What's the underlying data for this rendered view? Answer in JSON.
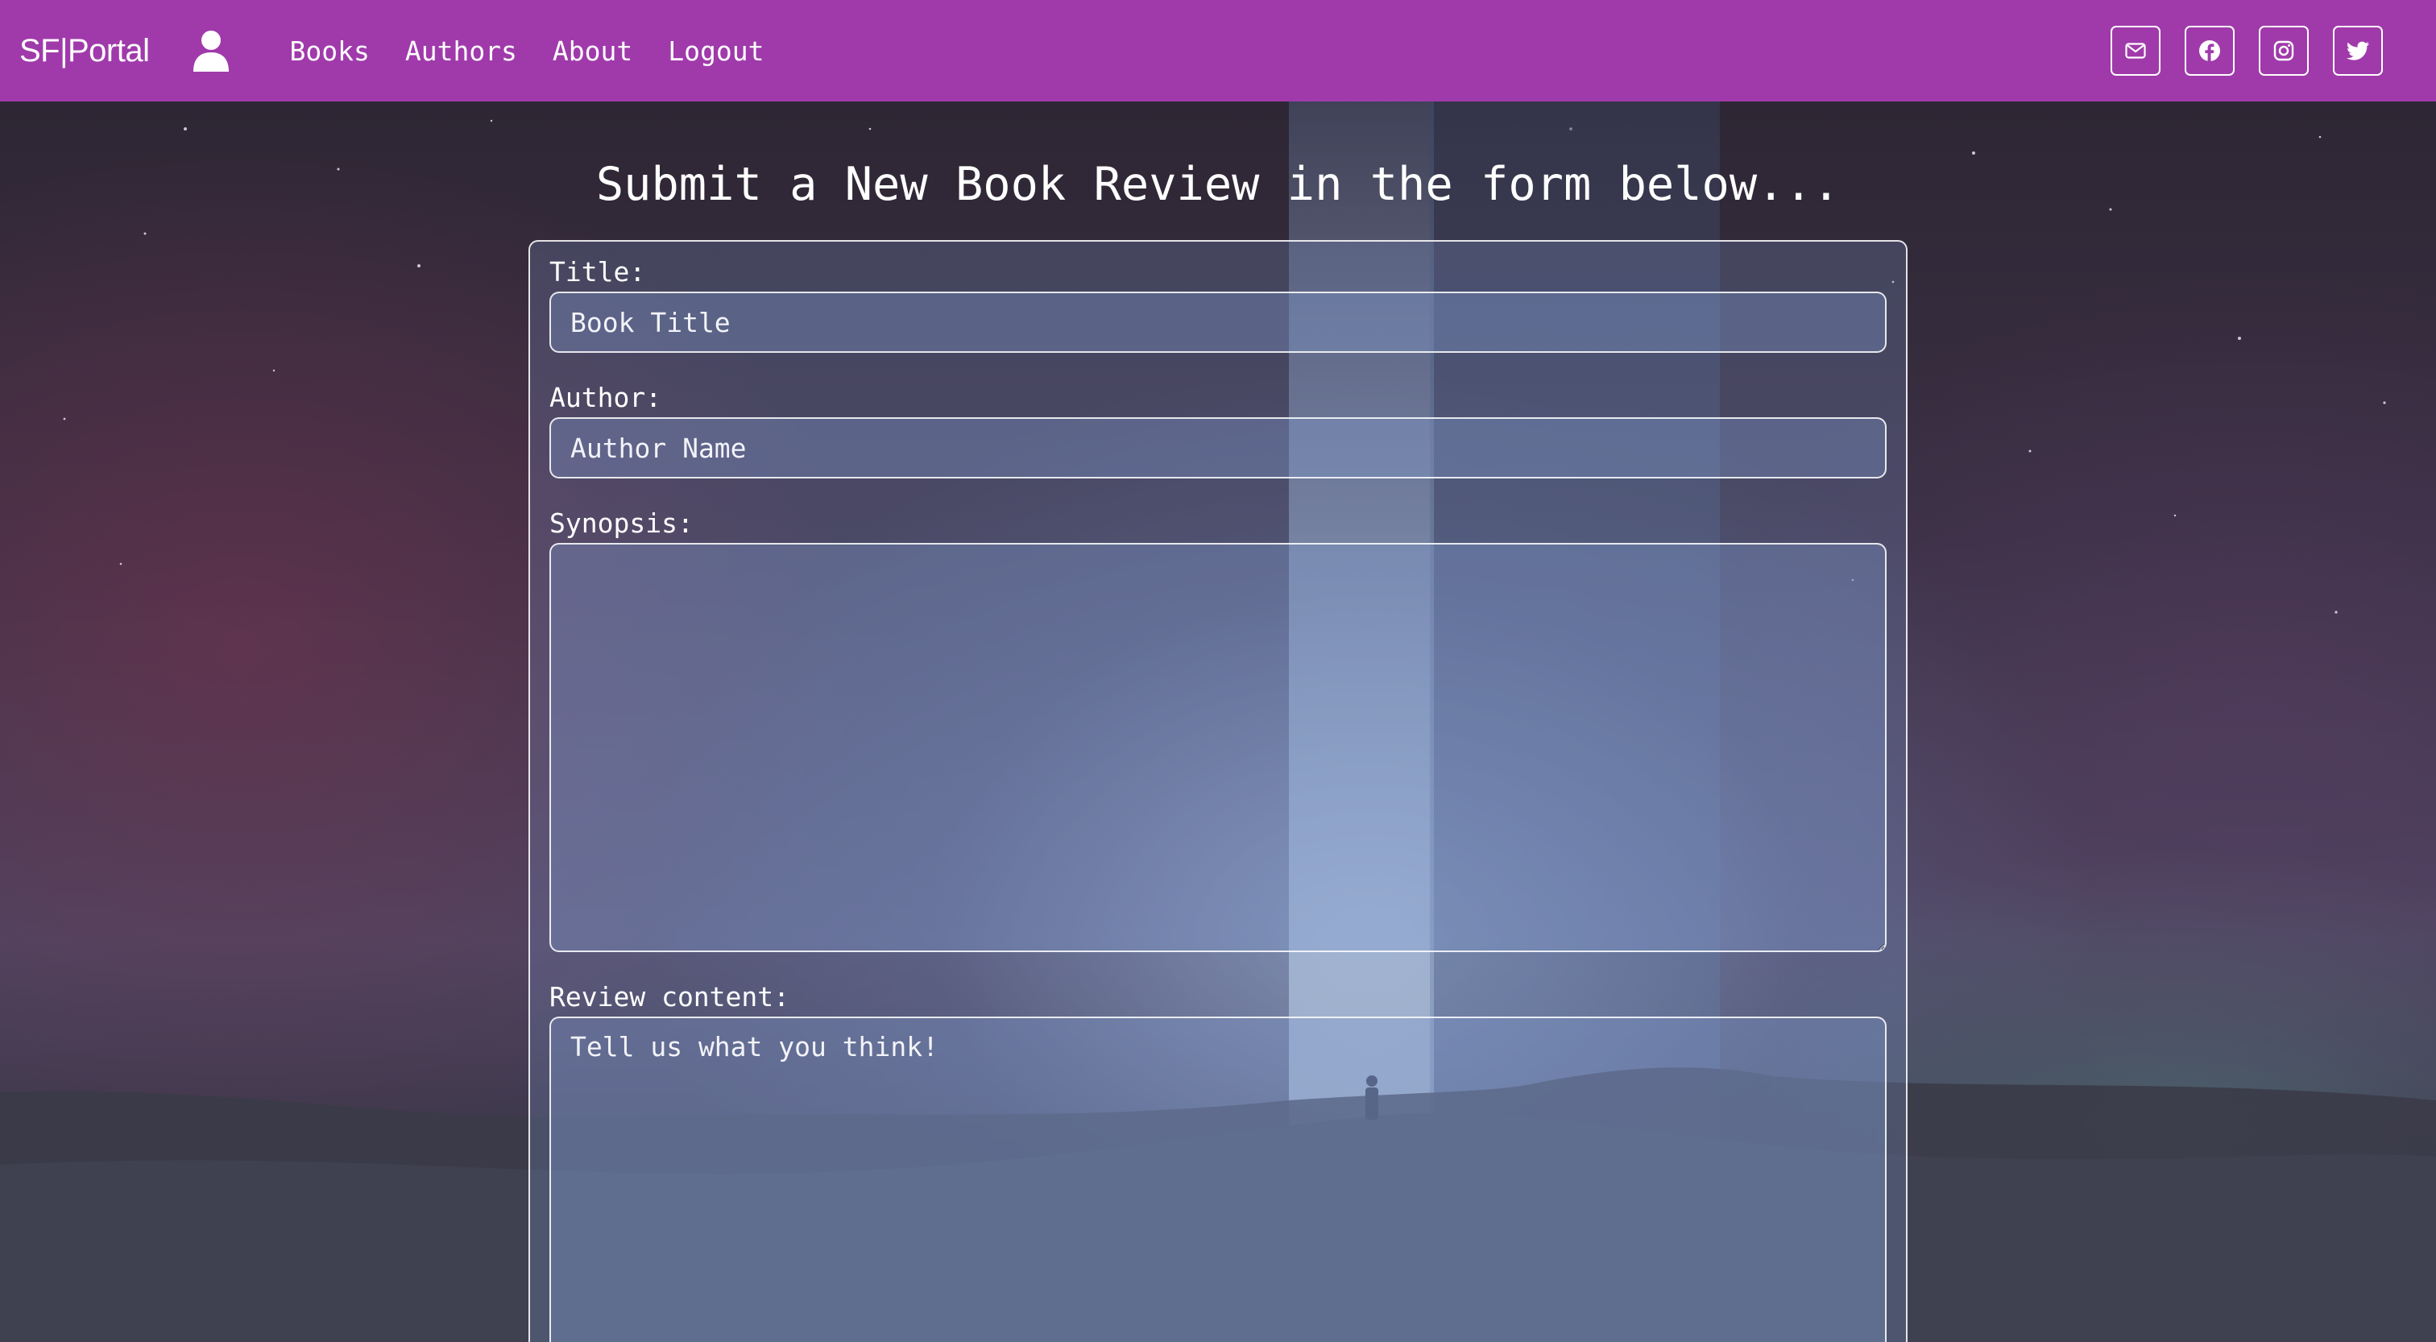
{
  "navbar": {
    "brand": "SF|Portal",
    "links": [
      "Books",
      "Authors",
      "About",
      "Logout"
    ],
    "social_icons": [
      "envelope-icon",
      "facebook-icon",
      "instagram-icon",
      "twitter-icon"
    ],
    "background_color": "#a03aab"
  },
  "page": {
    "heading": "Submit a New Book Review in the form below..."
  },
  "form": {
    "title_label": "Title:",
    "title_placeholder": "Book Title",
    "title_value": "",
    "author_label": "Author:",
    "author_placeholder": "Author Name",
    "author_value": "",
    "synopsis_label": "Synopsis:",
    "synopsis_placeholder": "",
    "synopsis_value": "",
    "review_label": "Review content:",
    "review_placeholder": "Tell us what you think!",
    "review_value": ""
  }
}
